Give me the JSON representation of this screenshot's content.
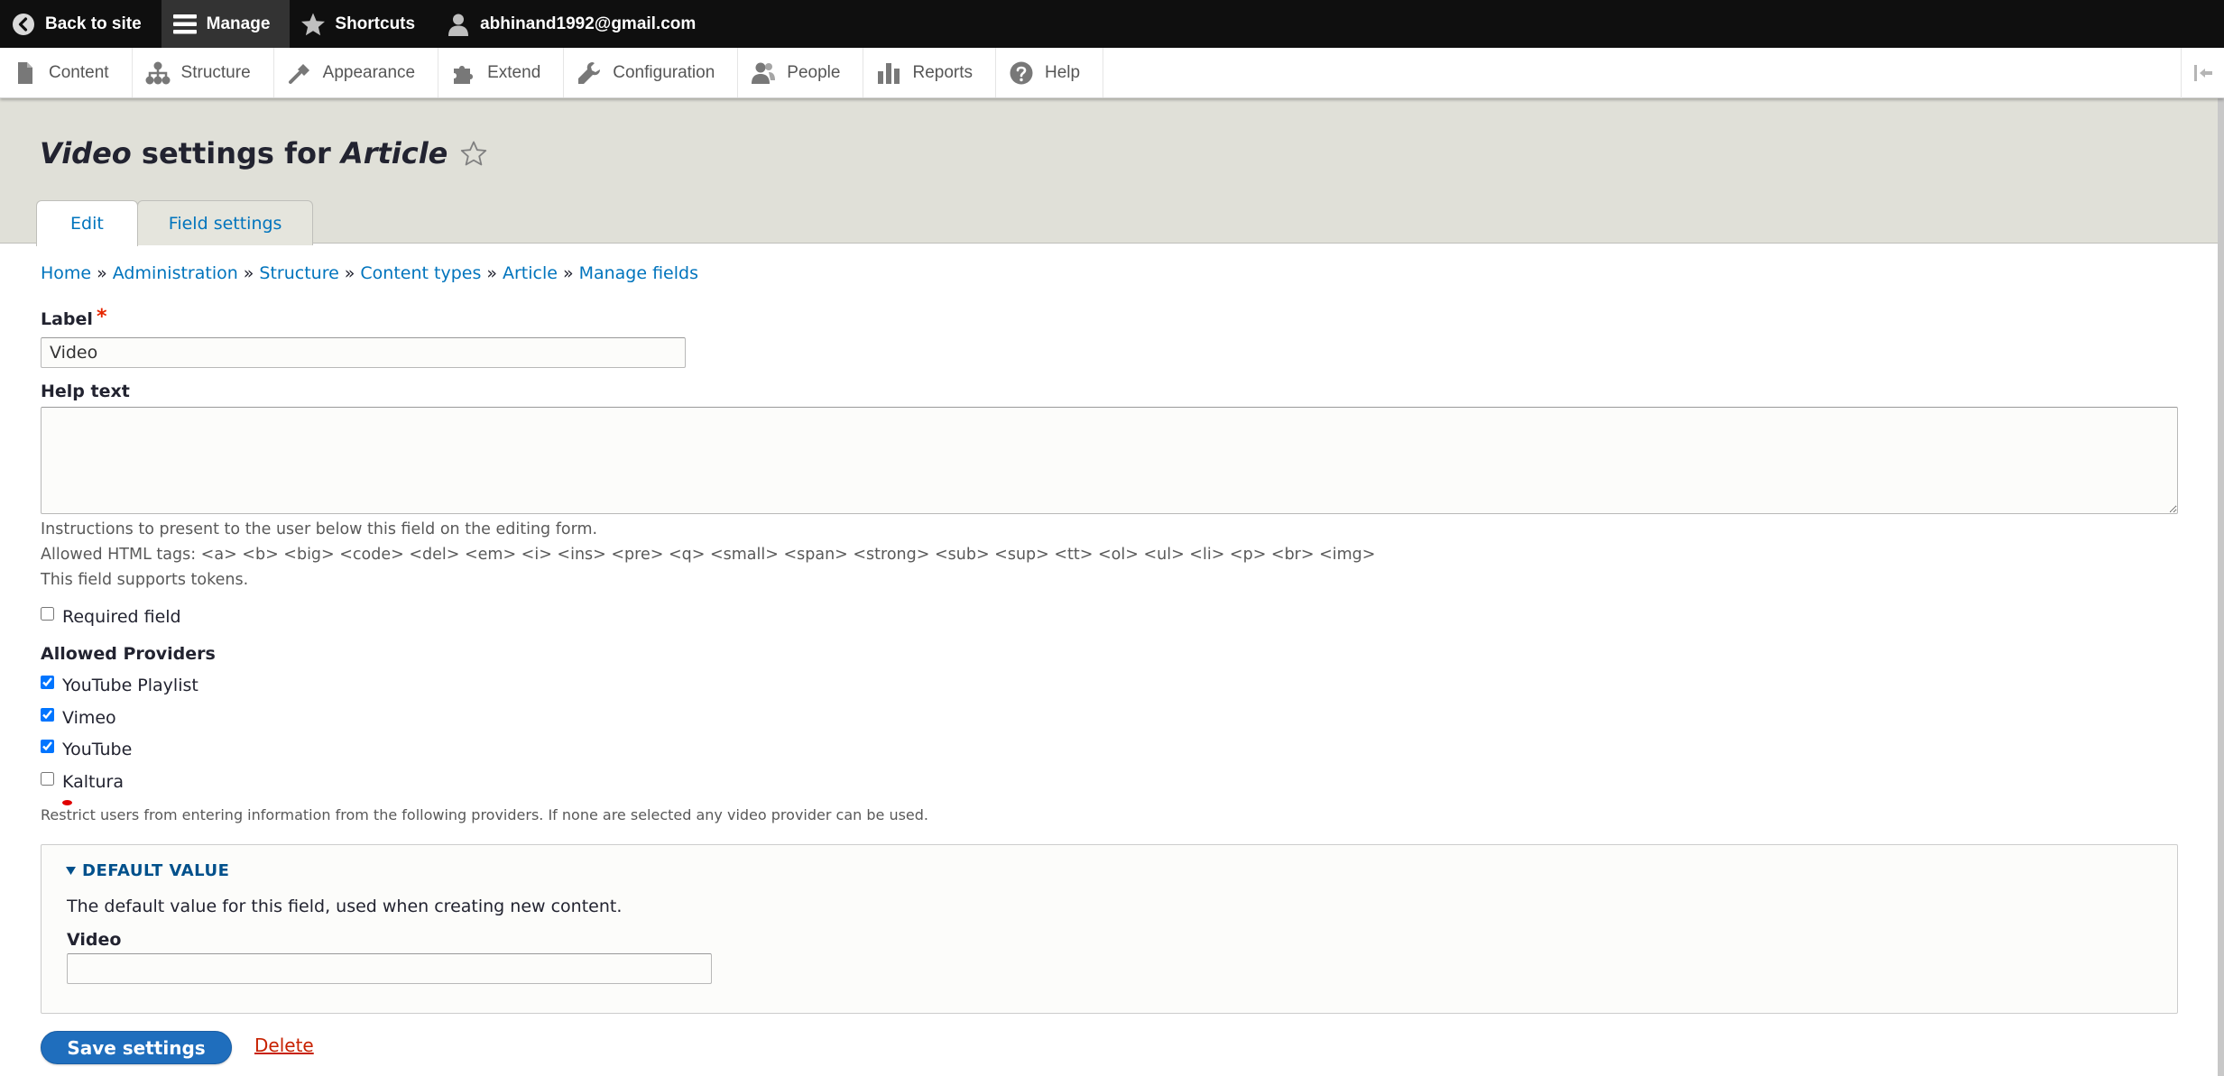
{
  "toolbar": {
    "back_to_site": "Back to site",
    "manage": "Manage",
    "shortcuts": "Shortcuts",
    "user": "abhinand1992@gmail.com"
  },
  "tray": {
    "items": [
      {
        "label": "Content",
        "icon": "file-icon"
      },
      {
        "label": "Structure",
        "icon": "sitemap-icon"
      },
      {
        "label": "Appearance",
        "icon": "brush-icon"
      },
      {
        "label": "Extend",
        "icon": "puzzle-icon"
      },
      {
        "label": "Configuration",
        "icon": "wrench-icon"
      },
      {
        "label": "People",
        "icon": "people-icon"
      },
      {
        "label": "Reports",
        "icon": "bar-chart-icon"
      },
      {
        "label": "Help",
        "icon": "help-icon"
      }
    ]
  },
  "page": {
    "title_field": "Video",
    "title_mid": " settings for ",
    "title_type": "Article",
    "tabs": [
      {
        "label": "Edit",
        "active": true
      },
      {
        "label": "Field settings",
        "active": false
      }
    ]
  },
  "breadcrumb": [
    "Home",
    "Administration",
    "Structure",
    "Content types",
    "Article",
    "Manage fields"
  ],
  "form": {
    "label": {
      "title": "Label",
      "value": "Video"
    },
    "help_text": {
      "title": "Help text",
      "value": "",
      "desc_1": "Instructions to present to the user below this field on the editing form.",
      "desc_2": "Allowed HTML tags: <a> <b> <big> <code> <del> <em> <i> <ins> <pre> <q> <small> <span> <strong> <sub> <sup> <tt> <ol> <ul> <li> <p> <br> <img>",
      "desc_3": "This field supports tokens."
    },
    "required": {
      "label": "Required field",
      "checked": false
    },
    "providers": {
      "title": "Allowed Providers",
      "options": [
        {
          "label": "YouTube Playlist",
          "checked": true
        },
        {
          "label": "Vimeo",
          "checked": true
        },
        {
          "label": "YouTube",
          "checked": true
        },
        {
          "label": "Kaltura",
          "checked": false
        }
      ],
      "desc": "Restrict users from entering information from the following providers. If none are selected any video provider can be used."
    },
    "default_value": {
      "summary": "DEFAULT VALUE",
      "desc": "The default value for this field, used when creating new content.",
      "field_label": "Video",
      "field_value": ""
    }
  },
  "actions": {
    "save": "Save settings",
    "delete": "Delete"
  },
  "colors": {
    "link": "#0074bd",
    "primary_button": "#1f6ebd",
    "delete": "#c72100",
    "header_bg": "#e0e0d8",
    "toolbar_bg": "#0f0f0f"
  }
}
